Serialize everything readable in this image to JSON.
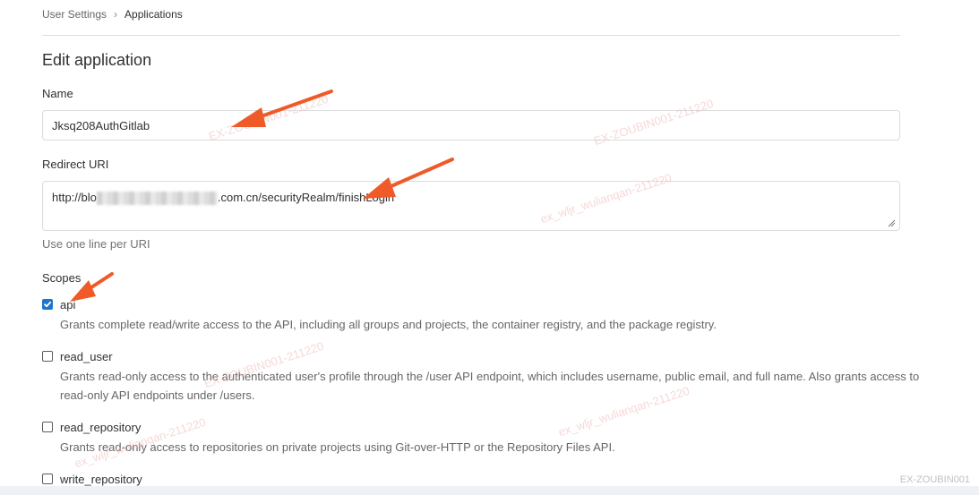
{
  "breadcrumb": {
    "parent": "User Settings",
    "separator": "›",
    "current": "Applications"
  },
  "page": {
    "title": "Edit application"
  },
  "form": {
    "name_label": "Name",
    "name_value": "Jksq208AuthGitlab",
    "redirect_label": "Redirect URI",
    "redirect_prefix": "http://blo",
    "redirect_suffix": ".com.cn/securityRealm/finishLogin",
    "redirect_help": "Use one line per URI",
    "scopes_label": "Scopes"
  },
  "scopes": [
    {
      "name": "api",
      "checked": true,
      "description": "Grants complete read/write access to the API, including all groups and projects, the container registry, and the package registry."
    },
    {
      "name": "read_user",
      "checked": false,
      "description": "Grants read-only access to the authenticated user's profile through the /user API endpoint, which includes username, public email, and full name. Also grants access to read-only API endpoints under /users."
    },
    {
      "name": "read_repository",
      "checked": false,
      "description": "Grants read-only access to repositories on private projects using Git-over-HTTP or the Repository Files API."
    },
    {
      "name": "write_repository",
      "checked": false,
      "description": ""
    }
  ],
  "watermarks": {
    "text_a": "ex_wljr_wulianqan-211220",
    "text_b": "EX-ZOUBIN001-211220",
    "corner_id": "EX-ZOUBIN001"
  },
  "colors": {
    "checkbox_checked": "#1f75cb",
    "annotation_arrow": "#f05a28",
    "watermark": "#f0b7b7"
  }
}
